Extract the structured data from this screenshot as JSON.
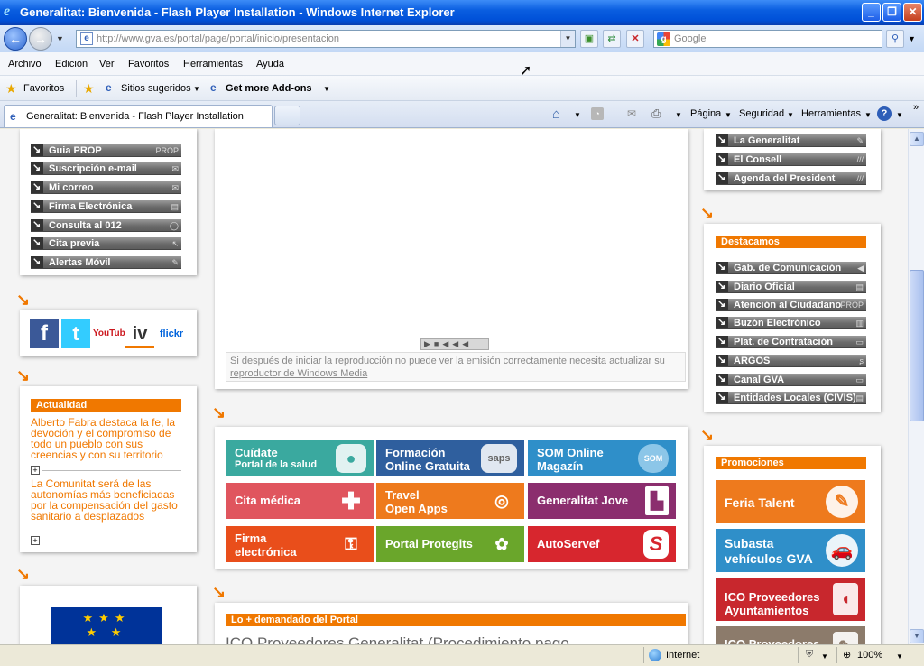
{
  "window": {
    "title": "Generalitat: Bienvenida - Flash Player Installation - Windows Internet Explorer",
    "min": "_",
    "max": "❐",
    "close": "✕"
  },
  "address": {
    "url": "http://www.gva.es/portal/page/portal/inicio/presentacion",
    "search_placeholder": "Google"
  },
  "menubar": [
    "Archivo",
    "Edición",
    "Ver",
    "Favoritos",
    "Herramientas",
    "Ayuda"
  ],
  "favbar": {
    "favorites": "Favoritos",
    "suggested": "Sitios sugeridos",
    "addons": "Get more Add-ons"
  },
  "tab": {
    "title": "Generalitat: Bienvenida - Flash Player Installation"
  },
  "commandbar": {
    "page": "Página",
    "security": "Seguridad",
    "tools": "Herramientas"
  },
  "left": {
    "links": [
      "Guia PROP",
      "Suscripción e-mail",
      "Mi correo",
      "Firma Electrónica",
      "Consulta al 012",
      "Cita previa",
      "Alertas Móvil"
    ],
    "social": [
      "f",
      "t",
      "YouTube",
      "iv",
      "flickr"
    ],
    "actualidad_title": "Actualidad",
    "news": [
      "Alberto Fabra destaca la fe, la devoción y el compromiso de todo un pueblo con sus creencias y con su territorio",
      "La Comunitat será de las autonomías más beneficiadas por la compensación del gasto sanitario a desplazados"
    ]
  },
  "center": {
    "player_notice": "Si después de iniciar la reproducción no puede ver la emisión correctamente",
    "player_link": "necesita actualizar su reproductor de Windows Media",
    "tiles": [
      {
        "l1": "Cuídate",
        "l2": "Portal de la salud",
        "color": "#3aa99f"
      },
      {
        "l1": "Formación",
        "l2": "Online Gratuita",
        "color": "#2f5f9e"
      },
      {
        "l1": "SOM Online",
        "l2": "Magazín",
        "color": "#2f8fc9"
      },
      {
        "l1": "Cita médica",
        "l2": "",
        "color": "#e0555e"
      },
      {
        "l1": "Travel",
        "l2": "Open Apps",
        "color": "#ee7a1d"
      },
      {
        "l1": "Generalitat Jove",
        "l2": "",
        "color": "#8b2e6e"
      },
      {
        "l1": "Firma",
        "l2": "electrónica",
        "color": "#e94e1b"
      },
      {
        "l1": "Portal Protegits",
        "l2": "",
        "color": "#6aa62b"
      },
      {
        "l1": "AutoServef",
        "l2": "",
        "color": "#d7262e"
      }
    ],
    "demandado_title": "Lo + demandado del Portal",
    "demandado_item": "ICO Proveedores Generalitat (Procedimiento pago"
  },
  "right": {
    "top_links": [
      "La Generalitat",
      "El Consell",
      "Agenda del President"
    ],
    "destacamos_title": "Destacamos",
    "destacamos": [
      "Gab. de Comunicación",
      "Diario Oficial",
      "Atención al Ciudadano",
      "Buzón Electrónico",
      "Plat. de Contratación",
      "ARGOS",
      "Canal GVA",
      "Entidades Locales (CIVIS)"
    ],
    "promociones_title": "Promociones",
    "promos": [
      {
        "l1": "Feria Talent",
        "l2": "",
        "color": "#ee7a1d"
      },
      {
        "l1": "Subasta",
        "l2": "vehículos GVA",
        "color": "#2f8fc9"
      },
      {
        "l1": "ICO Proveedores",
        "l2": "Ayuntamientos",
        "color": "#c8272d"
      },
      {
        "l1": "ICO Proveedores",
        "l2": "",
        "color": "#8c7b6b"
      }
    ]
  },
  "status": {
    "zone": "Internet",
    "zoom": "100%"
  }
}
